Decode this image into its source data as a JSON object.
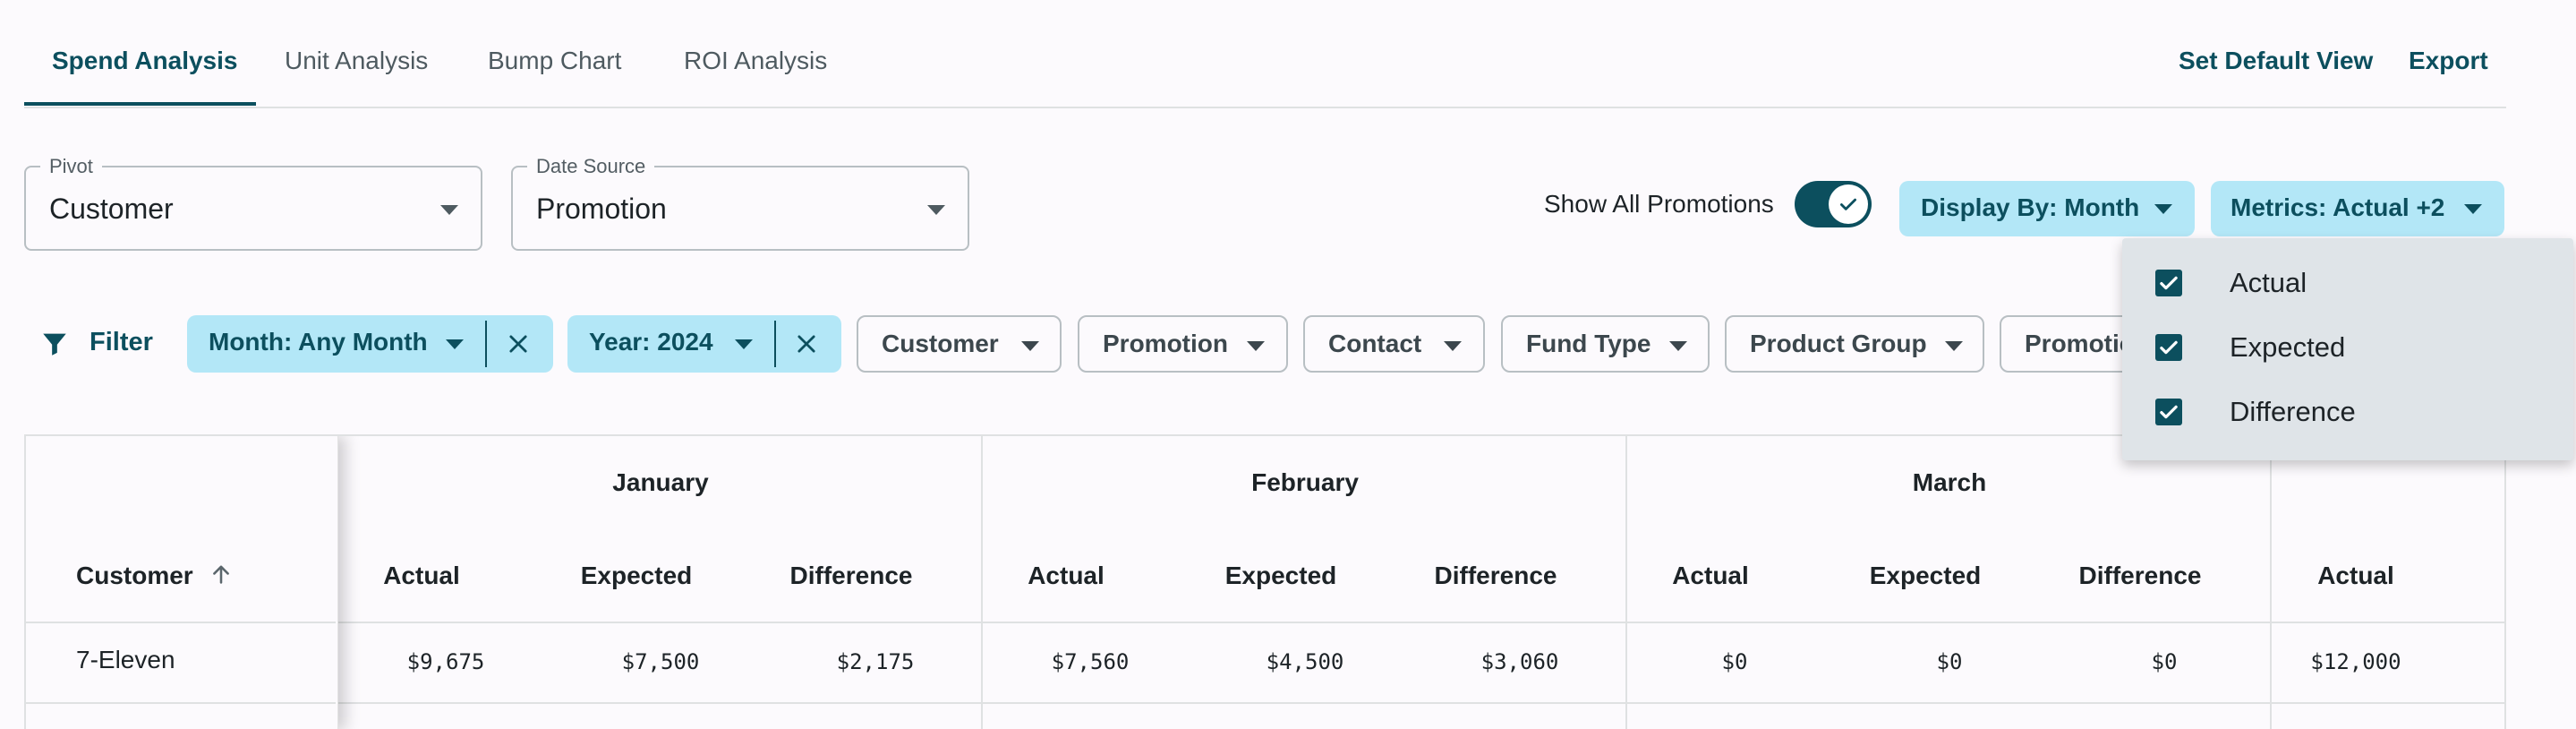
{
  "tabs": [
    {
      "label": "Spend Analysis",
      "active": true
    },
    {
      "label": "Unit Analysis",
      "active": false
    },
    {
      "label": "Bump Chart",
      "active": false
    },
    {
      "label": "ROI Analysis",
      "active": false
    }
  ],
  "actions": {
    "set_default_view": "Set Default View",
    "export": "Export"
  },
  "pivot": {
    "legend": "Pivot",
    "value": "Customer"
  },
  "date_source": {
    "legend": "Date Source",
    "value": "Promotion"
  },
  "show_all_promotions": {
    "label": "Show All Promotions",
    "on": true
  },
  "display_by": "Display By: Month",
  "metrics": "Metrics: Actual +2",
  "filter_label": "Filter",
  "active_filters": [
    "Month: Any Month",
    "Year: 2024"
  ],
  "filter_chips": [
    "Customer",
    "Promotion",
    "Contact",
    "Fund Type",
    "Product Group",
    "Promotio"
  ],
  "metrics_menu": [
    {
      "label": "Actual",
      "checked": true
    },
    {
      "label": "Expected",
      "checked": true
    },
    {
      "label": "Difference",
      "checked": true
    }
  ],
  "table": {
    "row_header": "Customer",
    "months": [
      "January",
      "February",
      "March"
    ],
    "columns": [
      "Actual",
      "Expected",
      "Difference",
      "Actual",
      "Expected",
      "Difference",
      "Actual",
      "Expected",
      "Difference",
      "Actual"
    ],
    "rows": [
      {
        "customer": "7-Eleven",
        "values": [
          "$9,675",
          "$7,500",
          "$2,175",
          "$7,560",
          "$4,500",
          "$3,060",
          "$0",
          "$0",
          "$0",
          "$12,000"
        ]
      }
    ]
  },
  "colors": {
    "primary": "#0c4f5e",
    "chip_active": "#b3e7f7",
    "menu_bg": "#dfe4e8"
  }
}
